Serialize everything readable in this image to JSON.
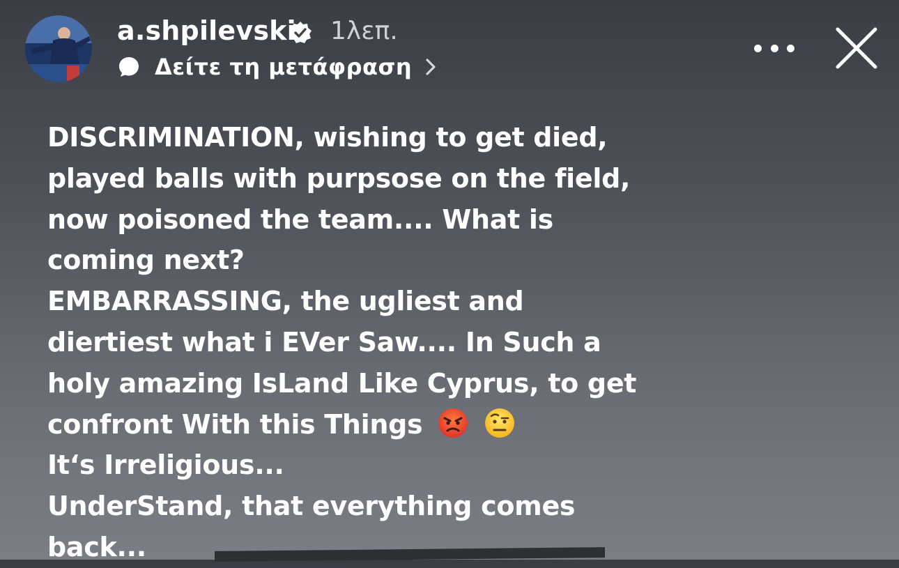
{
  "story": {
    "username": "a.shpilevski",
    "time_ago": "1λεπ.",
    "translate_label": "Δείτε τη μετάφραση",
    "icons": {
      "avatar": "profile-photo",
      "verified": "verified-badge-icon",
      "translate": "speech-bubble-icon",
      "chevron": "chevron-right-icon",
      "more": "more-horizontal-icon",
      "close": "close-icon"
    }
  },
  "post": {
    "lines": [
      "DISCRIMINATION, wishing to get died,",
      "played balls with purpsose on the field,",
      "now poisoned the team.... What is",
      "coming next?",
      "EMBARRASSING, the ugliest and",
      "diertiest what i EVer Saw.... In Such a",
      "holy amazing IsLand Like Cyprus, to get",
      "confront With this Things",
      "It‘s Irreligious...",
      "UnderStand, that everything comes",
      "back..."
    ],
    "emojis": [
      "angry-face-icon",
      "raised-eyebrow-face-icon"
    ]
  },
  "colors": {
    "background_top": "#3a3d43",
    "background_bottom": "#7b7e84",
    "text": "#ffffff",
    "verified_badge": "#ffffff"
  }
}
